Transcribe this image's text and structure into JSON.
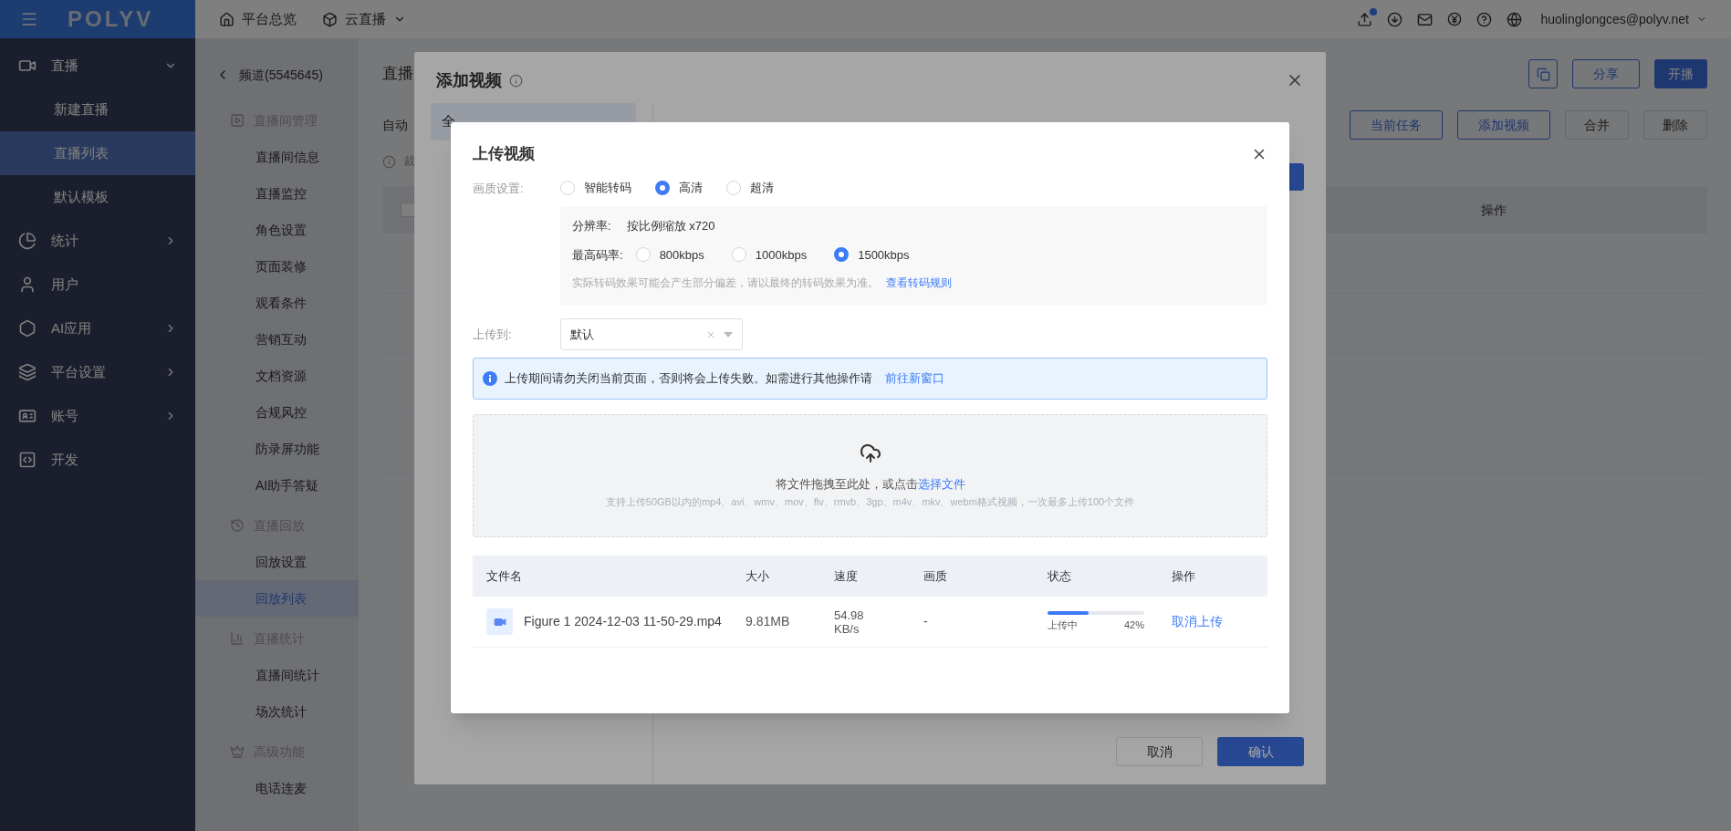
{
  "top_bar": {
    "logo": "POLYV",
    "nav": [
      "平台总览",
      "云直播"
    ],
    "user": "huolinglongces@polyv.net"
  },
  "sidebar": {
    "items": [
      {
        "label": "直播",
        "expanded": true,
        "children": [
          {
            "label": "新建直播",
            "selected": false
          },
          {
            "label": "直播列表",
            "selected": true
          },
          {
            "label": "默认模板",
            "selected": false
          }
        ]
      },
      {
        "label": "统计",
        "expanded": false
      },
      {
        "label": "用户"
      },
      {
        "label": "AI应用",
        "expanded": false
      },
      {
        "label": "平台设置",
        "expanded": false
      },
      {
        "label": "账号",
        "expanded": false
      },
      {
        "label": "开发"
      }
    ]
  },
  "subnav": {
    "back_label": "频道(5545645)",
    "groups": [
      {
        "title": "直播间管理",
        "items": [
          {
            "label": "直播间信息",
            "selected": false
          },
          {
            "label": "直播监控",
            "selected": false
          },
          {
            "label": "角色设置",
            "selected": false
          },
          {
            "label": "页面装修",
            "selected": false
          },
          {
            "label": "观看条件",
            "selected": false
          },
          {
            "label": "营销互动",
            "selected": false
          },
          {
            "label": "文档资源",
            "selected": false
          },
          {
            "label": "合规风控",
            "selected": false
          },
          {
            "label": "防录屏功能",
            "selected": false
          },
          {
            "label": "AI助手答疑",
            "selected": false
          }
        ]
      },
      {
        "title": "直播回放",
        "items": [
          {
            "label": "回放设置",
            "selected": false
          },
          {
            "label": "回放列表",
            "selected": true
          }
        ]
      },
      {
        "title": "直播统计",
        "items": [
          {
            "label": "直播间统计",
            "selected": false
          },
          {
            "label": "场次统计",
            "selected": false
          }
        ]
      },
      {
        "title": "高级功能",
        "items": [
          {
            "label": "电话连麦",
            "selected": false
          }
        ]
      }
    ]
  },
  "page": {
    "title": "直播",
    "toolbar_text": "自动",
    "notice": "裁",
    "header_buttons": [
      {
        "kind": "icon"
      },
      {
        "kind": "outline",
        "label": "分享"
      },
      {
        "kind": "primary",
        "label": "开播"
      }
    ],
    "action_buttons": [
      {
        "label": "当前任务",
        "disabled": false
      },
      {
        "label": "添加视频",
        "disabled": false
      },
      {
        "label": "合并",
        "disabled": true
      },
      {
        "label": "删除",
        "disabled": true
      }
    ],
    "table": {
      "select_all": {
        "checked": false
      },
      "columns": [
        {
          "label": "操作"
        }
      ]
    }
  },
  "add_modal": {
    "title": "添加视频",
    "tabs": [
      {
        "label": "全",
        "selected": true
      }
    ],
    "buttons": [
      {
        "label": "取消",
        "kind": "default"
      },
      {
        "label": "确认",
        "kind": "primary"
      }
    ]
  },
  "upload_modal": {
    "title": "上传视频",
    "quality": {
      "label": "画质设置:",
      "options": [
        {
          "label": "智能转码",
          "selected": false
        },
        {
          "label": "高清",
          "selected": true
        },
        {
          "label": "超清",
          "selected": false
        }
      ],
      "resolution_label": "分辨率:",
      "resolution": "按比例缩放 x720",
      "bitrate_label": "最高码率:",
      "bitrates": [
        {
          "label": "800kbps",
          "selected": false
        },
        {
          "label": "1000kbps",
          "selected": false
        },
        {
          "label": "1500kbps",
          "selected": true
        }
      ],
      "note": "实际转码效果可能会产生部分偏差，请以最终的转码效果为准。",
      "note_link": "查看转码规则"
    },
    "target": {
      "label": "上传到:",
      "value": "默认"
    },
    "alert": {
      "text": "上传期间请勿关闭当前页面，否则将会上传失败。如需进行其他操作请",
      "link": "前往新窗口"
    },
    "dropzone": {
      "text": "将文件拖拽至此处，或点击",
      "link": "选择文件",
      "hint": "支持上传50GB以内的mp4、avi、wmv、mov、flv、rmvb、3gp、m4v、mkv、webm格式视频，一次最多上传100个文件"
    },
    "table": {
      "columns": [
        "文件名",
        "大小",
        "速度",
        "画质",
        "状态",
        "操作"
      ],
      "rows": [
        {
          "name": "Figure 1 2024-12-03 11-50-29.mp4",
          "size": "9.81MB",
          "speed": "54.98 KB/s",
          "quality": "-",
          "status": "上传中",
          "percent": "42%",
          "level": 0.42,
          "action": "取消上传"
        }
      ]
    }
  }
}
